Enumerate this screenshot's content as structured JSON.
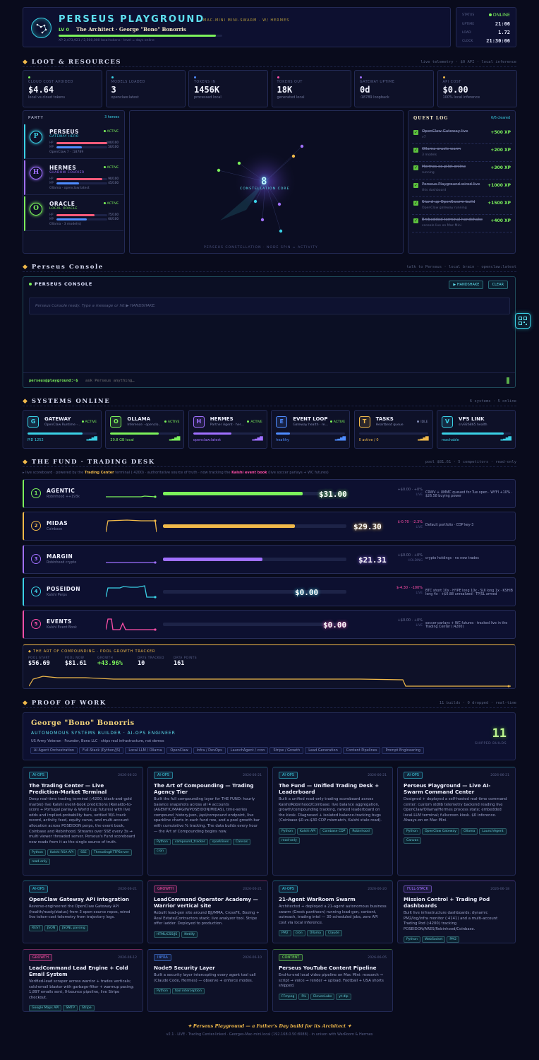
{
  "header": {
    "title": "Perseus Playground",
    "subtitle": "Mac-Mini Mini-Swarm · w/ Hermes",
    "level": "LV 0",
    "hero": "The Architect · George \"Bono\" Bonorris",
    "xp_text": "XP 2,473,921 / 2,500,000 local tokens · level = days online",
    "xp_fraction": 0.96,
    "status_label": "STATUS",
    "status_value": "ONLINE",
    "uptime_label": "UPTIME",
    "uptime_value": "21:06",
    "load_label": "LOAD",
    "load_value": "1.72",
    "clock_label": "CLOCK",
    "clock_value": "21:30:06"
  },
  "loot": {
    "title": "Loot & Resources",
    "right": "live telemetry · $0 API · local inference",
    "stats": [
      {
        "label": "CLOUD COST AVOIDED",
        "value": "$4.64",
        "sub": "local vs cloud tokens",
        "color": "#7cf25b"
      },
      {
        "label": "MODELS LOADED",
        "value": "3",
        "sub": "openclaw:latest",
        "color": "#3ad1e6"
      },
      {
        "label": "TOKENS IN",
        "value": "1456K",
        "sub": "processed local",
        "color": "#4f8cff"
      },
      {
        "label": "TOKENS OUT",
        "value": "18K",
        "sub": "generated local",
        "color": "#ff4fa8"
      },
      {
        "label": "GATEWAY UPTIME",
        "value": "0d",
        "sub": ":18789 loopback",
        "color": "#a070ff"
      },
      {
        "label": "API COST",
        "value": "$0.00",
        "sub": "100% local inference",
        "color": "#f0b94a"
      }
    ]
  },
  "party": {
    "title": "PARTY",
    "count": "3 heroes",
    "members": [
      {
        "initial": "P",
        "name": "PERSEUS",
        "role": "GATEWAY HERO",
        "status": "ACTIVE",
        "hp": "100/100",
        "mp": "50/100",
        "hp_frac": 1.0,
        "mp_frac": 0.5,
        "footer": "OpenClaw 7 · :18789",
        "color": "#3ad1e6"
      },
      {
        "initial": "H",
        "name": "HERMES",
        "role": "SHADOW COURIER",
        "status": "ACTIVE",
        "hp": "90/100",
        "mp": "45/100",
        "hp_frac": 0.9,
        "mp_frac": 0.45,
        "footer": "Ollama · openclaw:latest",
        "color": "#a070ff"
      },
      {
        "initial": "O",
        "name": "ORACLE",
        "role": "LOCAL ORACLE",
        "status": "ACTIVE",
        "hp": "75/100",
        "mp": "60/100",
        "hp_frac": 0.75,
        "mp_frac": 0.6,
        "footer": "Ollama · 3 model(s)",
        "color": "#7cf25b"
      }
    ]
  },
  "constellation": {
    "core_value": "8",
    "core_label": "CONSTELLATION CORE",
    "footer": "PERSEUS CONSTELLATION · NODE SPIN = ACTIVITY"
  },
  "quest": {
    "title": "QUEST LOG",
    "count": "6/6 cleared",
    "items": [
      {
        "title": "OpenClaw Gateway live",
        "sub": "v7",
        "xp": "+500 XP"
      },
      {
        "title": "Ollama oracle warm",
        "sub": "3 models",
        "xp": "+200 XP"
      },
      {
        "title": "Hermes co-pilot online",
        "sub": "running",
        "xp": "+300 XP"
      },
      {
        "title": "Perseus Playground wired live",
        "sub": "this dashboard",
        "xp": "+1000 XP"
      },
      {
        "title": "Stand up OpenSwarm build",
        "sub": "OpenClaw gateway running",
        "xp": "+1500 XP"
      },
      {
        "title": "Embedded terminal handshake",
        "sub": "console live on Mac Mini",
        "xp": "+400 XP"
      }
    ]
  },
  "console": {
    "section_title": "Perseus Console",
    "section_right": "talk to Perseus · local brain · openclaw:latest",
    "title": "PERSEUS CONSOLE",
    "handshake": "▶ HANDSHAKE",
    "clear": "CLEAR",
    "message": "Perseus Console ready. Type a message or hit ▶ HANDSHAKE.",
    "prompt": "perseus@playground:~$",
    "placeholder": "ask Perseus anything…"
  },
  "systems": {
    "title": "Systems Online",
    "right": "6 systems · 5 online",
    "items": [
      {
        "icon": "G",
        "name": "GATEWAY",
        "sub": "OpenClaw Runtime ·…",
        "status": "ACTIVE",
        "foot": "PID 1252",
        "fill": 0.8,
        "color": "#3ad1e6"
      },
      {
        "icon": "O",
        "name": "OLLAMA",
        "sub": "Inference · openclo…",
        "status": "ACTIVE",
        "foot": "20.8 GB local",
        "fill": 0.7,
        "color": "#7cf25b"
      },
      {
        "icon": "H",
        "name": "HERMES",
        "sub": "Partner Agent · her…",
        "status": "ACTIVE",
        "foot": "openclaw:latest",
        "fill": 0.55,
        "color": "#a070ff"
      },
      {
        "icon": "E",
        "name": "EVENT LOOP",
        "sub": "Gateway health · re…",
        "status": "ACTIVE",
        "foot": "healthy",
        "fill": 0.2,
        "color": "#4f8cff"
      },
      {
        "icon": "T",
        "name": "TASKS",
        "sub": "Heartbeat queue",
        "status": "IDLE",
        "foot": "0 active / 0",
        "fill": 0.0,
        "color": "#f0b94a"
      },
      {
        "icon": "V",
        "name": "VPS LINK",
        "sub": "srv926865 health",
        "status": "",
        "foot": "reachable",
        "fill": 0.9,
        "color": "#3ad1e6"
      }
    ]
  },
  "fund": {
    "title": "The Fund · Trading Desk",
    "right": "pool $81.61 · 5 competitors · read-only",
    "note_pre": "▸ live scoreboard · powered by the",
    "note_tc": "Trading Center",
    "note_mid": "terminal (:4200) · authoritative source of truth · now tracking the",
    "note_kb": "Kalshi event book",
    "note_post": "(live soccer parlays + WC futures)",
    "rows": [
      {
        "rank": "1",
        "name": "AGENTIC",
        "sub": "Robinhood ++193k",
        "value": "$31.00",
        "bar": 0.95,
        "chg": "+$0.00 · +0%",
        "live": "LIVE",
        "note": "CRWV + UMMC queued for Tue open · WYFI +10% · $26.58 buying power",
        "color": "#7cf25b",
        "chg_color": "#6d7499"
      },
      {
        "rank": "2",
        "name": "MIDAS",
        "sub": "Coinbase",
        "value": "$29.30",
        "bar": 0.9,
        "chg": "$-0.70 · -2.3%",
        "live": "LIVE",
        "note": "Default portfolio · CDP key-3",
        "color": "#f0b94a",
        "chg_color": "#ff4fa8"
      },
      {
        "rank": "3",
        "name": "MARGIN",
        "sub": "Robinhood crypto",
        "value": "$21.31",
        "bar": 0.68,
        "chg": "+$0.00 · +0%",
        "live": "HOLDING",
        "note": "crypto holdings · no new trades",
        "color": "#a070ff",
        "chg_color": "#6d7499"
      },
      {
        "rank": "4",
        "name": "POSEIDON",
        "sub": "Kalshi Perps",
        "value": "$0.00",
        "bar": 0.0,
        "chg": "$-4.30 · -100%",
        "live": "LIVE",
        "note": "BTC short 10x · HYPE long 10x · SUI long 1x · KSHIB long 4x · +$0.88 unrealized · TP/SL armed",
        "color": "#3ad1e6",
        "chg_color": "#ff4fa8"
      },
      {
        "rank": "5",
        "name": "EVENTS",
        "sub": "Kalshi Event Book",
        "value": "$0.00",
        "bar": 0.0,
        "chg": "+$0.00 · +0%",
        "live": "LIVE",
        "note": "soccer parlays + WC futures · tracked live in the Trading Center (:4200)",
        "color": "#ff4fa8",
        "chg_color": "#6d7499"
      }
    ],
    "compound": {
      "title": "THE ART OF COMPOUNDING · POOL GROWTH TRACKER",
      "stats": [
        {
          "label": "POOL START",
          "value": "$56.69"
        },
        {
          "label": "POOL NOW",
          "value": "$81.61"
        },
        {
          "label": "GROWTH",
          "value": "+43.96%"
        },
        {
          "label": "DAYS TRACKED",
          "value": "10"
        },
        {
          "label": "DATA POINTS",
          "value": "161"
        }
      ]
    }
  },
  "proof": {
    "title": "Proof of Work",
    "right": "11 builds · 0 dropped · real-time",
    "name": "George \"Bono\" Bonorris",
    "role": "AUTONOMOUS SYSTEMS BUILDER · AI-OPS ENGINEER",
    "bio": "US Army Veteran · Founder, Bono LLC · ships real infrastructure, not demos",
    "shipped_value": "11",
    "shipped_label": "SHIPPED BUILDS",
    "skills": [
      "AI Agent Orchestration",
      "Full-Stack (Python/JS)",
      "Local LLM / Ollama",
      "OpenClaw",
      "Infra / DevOps",
      "LaunchAgent / cron",
      "Stripe / Growth",
      "Lead Generation",
      "Content Pipelines",
      "Prompt Engineering"
    ],
    "cards": [
      {
        "tag": "AI-OPS",
        "date": "2026-06-22",
        "title": "The Trading Center — Live Prediction-Market Terminal",
        "desc": "Deep real-time trading terminal (:4200, black-and-gold marble) live Kalshi event-book predictions (Ronaldo-to-score + Portugal parlay & World Cup futures) with live odds and implied-probability bars, settled W/L track record, activity feed, equity curve, and multi-account allocation across POSEIDON perps, the event book, Coinbase and Robinhood. Streams over SSE every 3s → multi viewer threaded server. Perseus's Fund scoreboard now reads from it as the single source of truth.",
        "techs": [
          "Python",
          "Kalshi RSA API",
          "SSE",
          "ThreadingHTTPServer",
          "read-only"
        ],
        "color": "#3ad1e6"
      },
      {
        "tag": "AI-OPS",
        "date": "2026-06-21",
        "title": "The Art of Compounding — Trading Agency Tier",
        "desc": "Built the full compounding layer for THE FUND: hourly balance snapshots across all 4 accounts (AGENTIC/MARGIN/POSEIDON/MIDAS), time-series compound_history.json, /api/compound endpoint, live sparkline charts in each fund row, and a pool growth bar with cumulative % tracking. The data builds every hour — the Art of Compounding begins now.",
        "techs": [
          "Python",
          "compound_tracker",
          "sparklines",
          "Canvas",
          "cron"
        ],
        "color": "#3ad1e6"
      },
      {
        "tag": "AI-OPS",
        "date": "2026-06-21",
        "title": "The Fund — Unified Trading Desk + Leaderboard",
        "desc": "Built a unified read-only trading scoreboard across Kalshi/Robinhood/Coinbase: live balance aggregation, growth/compounding tracking, ranked leaderboard on the kiosk. Diagnosed + isolated balance-tracking bugs (Coinbase $0-vs-$30 CDP mismatch, Kalshi stale read).",
        "techs": [
          "Python",
          "Kalshi API",
          "Coinbase CDP",
          "Robinhood",
          "read-only"
        ],
        "color": "#3ad1e6"
      },
      {
        "tag": "AI-OPS",
        "date": "2026-06-21",
        "title": "Perseus Playground — Live AI-Swarm Command Center",
        "desc": "Designed + deployed a self-hosted real-time command center: custom stdlib telemetry backend reading live OpenClaw/Ollama/Hermes process state; embedded local-LLM terminal; fullscreen kiosk. $0 inference. Always-on on Mac Mini.",
        "techs": [
          "Python",
          "OpenClaw Gateway",
          "Ollama",
          "LaunchAgent",
          "Canvas"
        ],
        "color": "#3ad1e6"
      },
      {
        "tag": "AI-OPS",
        "date": "2026-06-21",
        "title": "OpenClaw Gateway API integration",
        "desc": "Reverse-engineered the OpenClaw Gateway API (health/ready/status) from 3 open-source repos, wired live token-cost telemetry from trajectory logs.",
        "techs": [
          "REST",
          "JSON",
          "JSONL parsing"
        ],
        "color": "#3ad1e6"
      },
      {
        "tag": "GROWTH",
        "date": "2026-06-21",
        "title": "LeadCommand Operator Academy — Warrior vertical site",
        "desc": "Rebuilt lead-gen site around BJJ/MMA, CrossFit, Boxing + Real Estate/Contractors stack; live analyzer tool. Stripe offer ladder. Deployed to production.",
        "techs": [
          "HTML/CSS/JS",
          "Netlify"
        ],
        "color": "#ff4fa8"
      },
      {
        "tag": "AI-OPS",
        "date": "2026-06-20",
        "title": "21-Agent WarRoom Swarm",
        "desc": "Architected + deployed a 21-agent autonomous business swarm (Greek pantheon) running lead-gen, content, outreach, trading intel — 30 scheduled jobs, zero API cost via local inference.",
        "techs": [
          "PM2",
          "cron",
          "Ollama",
          "Claude"
        ],
        "color": "#3ad1e6"
      },
      {
        "tag": "FULL-STACK",
        "date": "2026-06-18",
        "title": "Mission Control + Trading Pod dashboards",
        "desc": "Built live infrastructure dashboards: dynamic PM2/log/infra monitor (:4141) and a multi-account Trading Pod (:4200) tracking POSEIDON/ARES/Robinhood/Coinbase.",
        "techs": [
          "Python",
          "WebSocket",
          "PM2"
        ],
        "color": "#a070ff"
      },
      {
        "tag": "GROWTH",
        "date": "2026-06-12",
        "title": "LeadCommand Lead Engine + Cold Email System",
        "desc": "Verified-lead scraper across warrior + trades verticals; cold-email blaster with garbage-filter + warmup pacing; 1,897 emails sent, 0-bounce pipeline, live Stripe checkout.",
        "techs": [
          "Google Maps API",
          "SMTP",
          "Stripe"
        ],
        "color": "#ff4fa8"
      },
      {
        "tag": "INFRA",
        "date": "2026-06-10",
        "title": "Node9 Security Layer",
        "desc": "Built a security layer intercepting every agent tool call (Claude Code, Hermes) — observe + enforce modes.",
        "techs": [
          "Python",
          "tool interception"
        ],
        "color": "#4f8cff"
      },
      {
        "tag": "CONTENT",
        "date": "2026-06-05",
        "title": "Perseus YouTube Content Pipeline",
        "desc": "End-to-end local video pipeline on Mac Mini: research → script → voice → render → upload. Football + USA shorts shipped.",
        "techs": [
          "FFmpeg",
          "PIL",
          "ElevenLabs",
          "yt-dlp"
        ],
        "color": "#7cf25b"
      }
    ]
  },
  "footer": {
    "line1": "✦ Perseus Playground — a Father's Day build for its Architect ✦",
    "line2": "v2.1 · LIVE · Trading Center-linked · Georges-Mac-mini.local (192.168.0.50:8088) · in unison with WarRoom & Hermes"
  },
  "colors": {
    "green": "#7cf25b",
    "cyan": "#3ad1e6",
    "gold": "#f0b94a",
    "pink": "#ff4fa8",
    "purple": "#a070ff",
    "bg": "#090b1c"
  }
}
